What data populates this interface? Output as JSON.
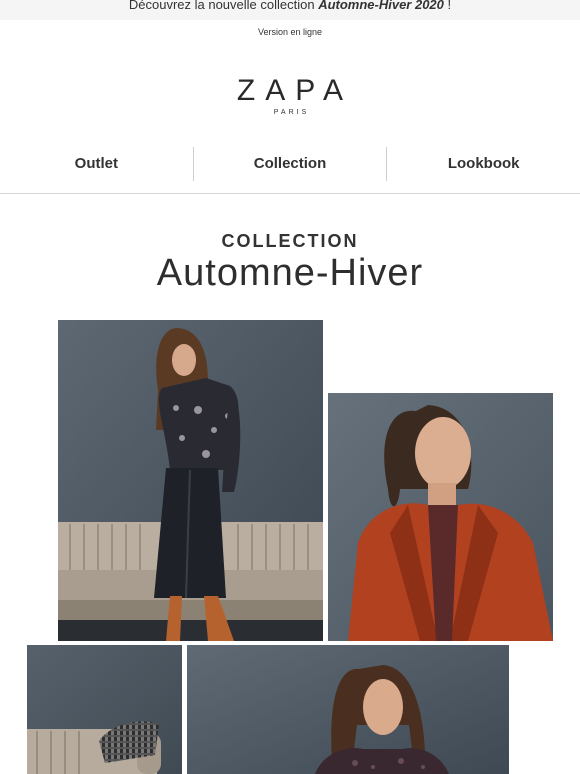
{
  "announcement": {
    "prefix": "Découvrez la nouvelle collection ",
    "highlight": "Automne-Hiver 2020",
    "suffix": " !"
  },
  "web_version_link": "Version en ligne",
  "logo": {
    "name": "ZAPA",
    "city": "PARIS"
  },
  "nav": [
    {
      "label": "Outlet"
    },
    {
      "label": "Collection"
    },
    {
      "label": "Lookbook"
    }
  ],
  "section": {
    "kicker": "COLLECTION",
    "title": "Automne-Hiver"
  },
  "colors": {
    "background": "#ffffff",
    "text": "#2b2b2b",
    "announcement_bg": "#f5f5f5",
    "divider": "#d4d4d4",
    "wall_gray": "#4a5560",
    "coat_rust": "#b2411f",
    "sofa_beige": "#b7ab9c",
    "boot_tan": "#b5622e"
  },
  "images": [
    {
      "name": "model-black-leather-skirt-photo"
    },
    {
      "name": "model-red-coat-photo"
    },
    {
      "name": "sofa-plaid-photo"
    },
    {
      "name": "model-dark-top-photo"
    }
  ]
}
